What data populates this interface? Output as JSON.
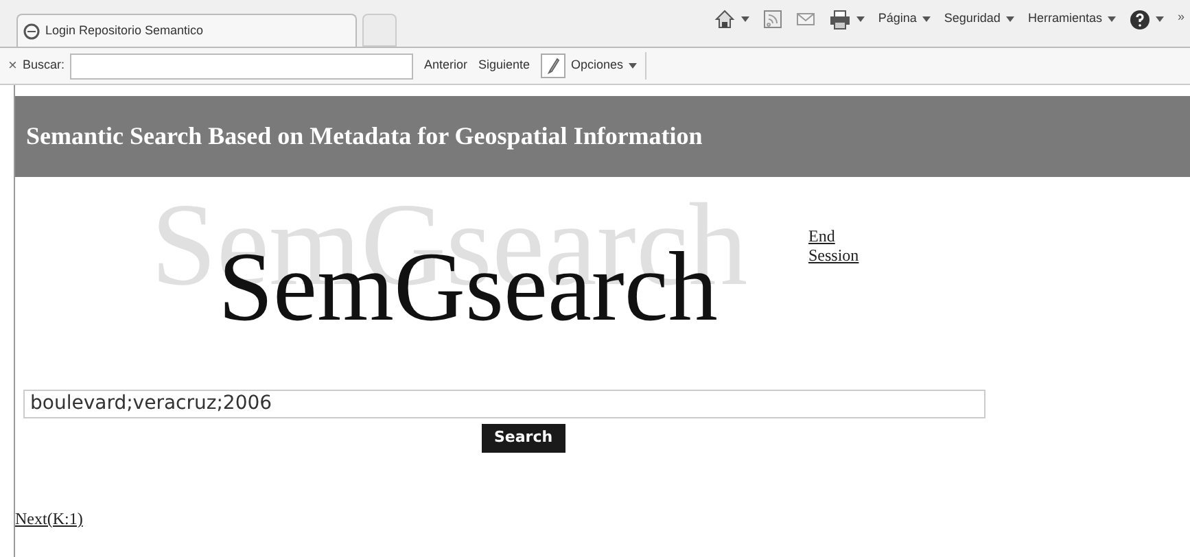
{
  "browser": {
    "tabs": [
      {
        "label": "Login Repositorio Semantico",
        "selected": true
      },
      {
        "selected": false
      }
    ],
    "command_bar": [
      {
        "kind": "home",
        "dropdown": true
      },
      {
        "kind": "feed",
        "dropdown": false
      },
      {
        "kind": "mail",
        "dropdown": false
      },
      {
        "kind": "print",
        "dropdown": true
      },
      {
        "kind": "menu",
        "label": "Página",
        "dropdown": true
      },
      {
        "kind": "menu",
        "label": "Seguridad",
        "dropdown": true
      },
      {
        "kind": "menu",
        "label": "Herramientas",
        "dropdown": true
      },
      {
        "kind": "help",
        "dropdown": true
      }
    ],
    "overflow": "»",
    "find_bar": {
      "close": "×",
      "label": "Buscar:",
      "previous": "Anterior",
      "next": "Siguiente",
      "options": "Opciones"
    }
  },
  "page": {
    "header": "Semantic Search Based on Metadata for Geospatial Information",
    "logo": {
      "shadow_text": "SemGsearch",
      "text": "SemGsearch"
    },
    "end_session": [
      "End",
      "Session"
    ],
    "search": {
      "value": "boulevard;veracruz;2006",
      "button": "Search"
    },
    "next_link": "Next(K:1)"
  }
}
